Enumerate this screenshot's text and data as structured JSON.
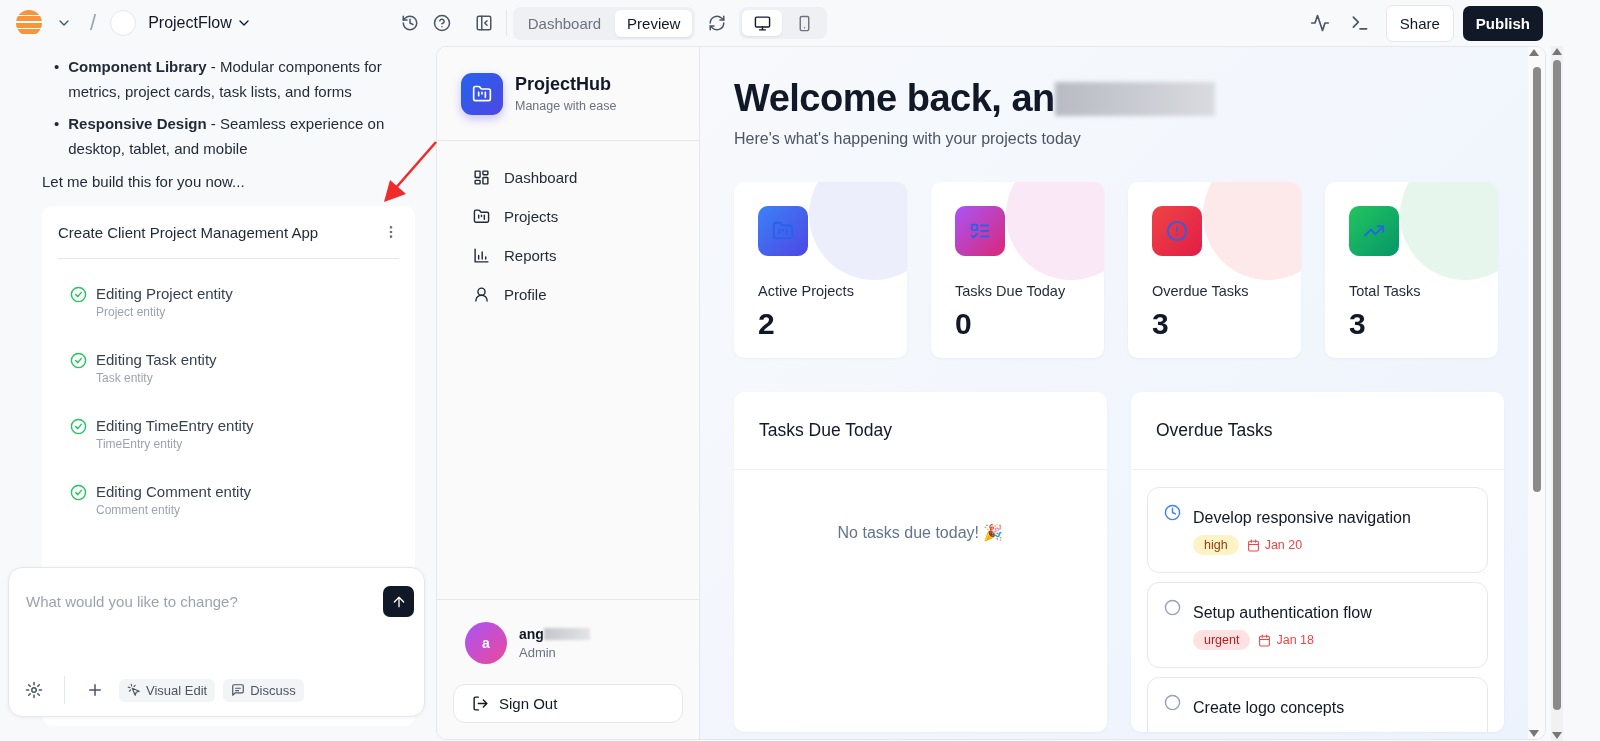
{
  "topbar": {
    "separator": "/",
    "project_name": "ProjectFlow",
    "view_tabs": [
      {
        "label": "Dashboard",
        "selected": false
      },
      {
        "label": "Preview",
        "selected": true
      }
    ],
    "devices": [
      {
        "kind": "desktop",
        "selected": true
      },
      {
        "kind": "mobile",
        "selected": false
      }
    ],
    "share": "Share",
    "publish": "Publish"
  },
  "chat": {
    "bullets": [
      {
        "marker": "•",
        "text": "**Component Library** - Modular components for metrics, project cards, task lists, and forms"
      },
      {
        "marker": "•",
        "text": "**Responsive Design** - Seamless experience on desktop, tablet, and mobile"
      }
    ],
    "message": "Let me build this for you now...",
    "task_card": {
      "title": "Create Client Project Management App",
      "steps": [
        {
          "title": "Editing Project entity",
          "subtitle": "Project entity",
          "done": true
        },
        {
          "title": "Editing Task entity",
          "subtitle": "Task entity",
          "done": true
        },
        {
          "title": "Editing TimeEntry entity",
          "subtitle": "TimeEntry entity",
          "done": true
        },
        {
          "title": "Editing Comment entity",
          "subtitle": "Comment entity",
          "done": true
        }
      ]
    },
    "composer": {
      "placeholder": "What would you like to change?",
      "buttons": [
        {
          "label": "Visual Edit",
          "kind": "visual-edit"
        },
        {
          "label": "Discuss",
          "kind": "discuss"
        }
      ]
    }
  },
  "app": {
    "brand": {
      "name": "ProjectHub",
      "tagline": "Manage with ease"
    },
    "nav": [
      {
        "label": "Dashboard",
        "kind": "grid"
      },
      {
        "label": "Projects",
        "kind": "folder"
      },
      {
        "label": "Reports",
        "kind": "chart"
      },
      {
        "label": "Profile",
        "kind": "user"
      }
    ],
    "user": {
      "initial": "a",
      "name": "ang",
      "role": "Admin"
    },
    "sign_out": "Sign Out"
  },
  "dashboard": {
    "greeting": "Welcome back, an",
    "subtitle": "Here's what's happening with your projects today",
    "stats": [
      {
        "label": "Active Projects",
        "value": "2",
        "kind": "folder",
        "color": "#eceefc"
      },
      {
        "label": "Tasks Due Today",
        "value": "0",
        "kind": "checklist",
        "color": "#fae8f6"
      },
      {
        "label": "Overdue Tasks",
        "value": "3",
        "kind": "alert",
        "color": "#fde8ea"
      },
      {
        "label": "Total Tasks",
        "value": "3",
        "kind": "trend",
        "color": "#e7f6ec"
      }
    ],
    "due_today": {
      "title": "Tasks Due Today",
      "empty_message": "No tasks due today! 🎉"
    },
    "overdue": {
      "title": "Overdue Tasks",
      "tasks": [
        {
          "title": "Develop responsive navigation",
          "in_progress": true,
          "priority": {
            "label": "high",
            "kind": "high"
          },
          "due": "Jan 20"
        },
        {
          "title": "Setup authentication flow",
          "in_progress": false,
          "priority": {
            "label": "urgent",
            "kind": "urgent"
          },
          "due": "Jan 18"
        },
        {
          "title": "Create logo concepts",
          "in_progress": false
        }
      ]
    }
  }
}
